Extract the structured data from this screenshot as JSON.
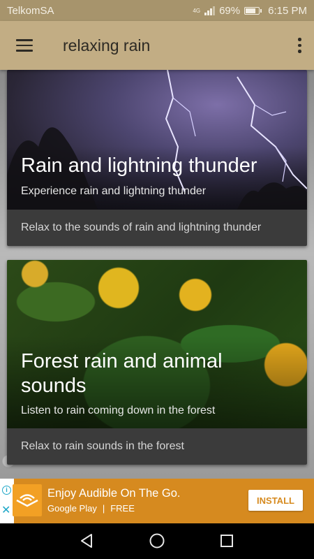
{
  "status_bar": {
    "carrier": "TelkomSA",
    "network": "4G",
    "battery": "69%",
    "time": "6:15 PM"
  },
  "app_bar": {
    "title": "relaxing rain"
  },
  "cards": [
    {
      "title": "Rain and lightning thunder",
      "subtitle": "Experience rain and lightning thunder",
      "description": "Relax to the sounds of rain and lightning thunder"
    },
    {
      "title": "Forest rain and animal sounds",
      "subtitle": "Listen to rain coming down in the forest",
      "description": "Relax to rain sounds in the forest"
    }
  ],
  "ad": {
    "headline": "Enjoy Audible On The Go.",
    "store": "Google Play",
    "separator": "|",
    "price": "FREE",
    "button": "INSTALL",
    "accent_color": "#d68a1f"
  },
  "icons": {
    "menu": "menu-icon",
    "more": "more-vert-icon",
    "back": "back-icon",
    "home": "home-icon",
    "recents": "recents-icon"
  }
}
